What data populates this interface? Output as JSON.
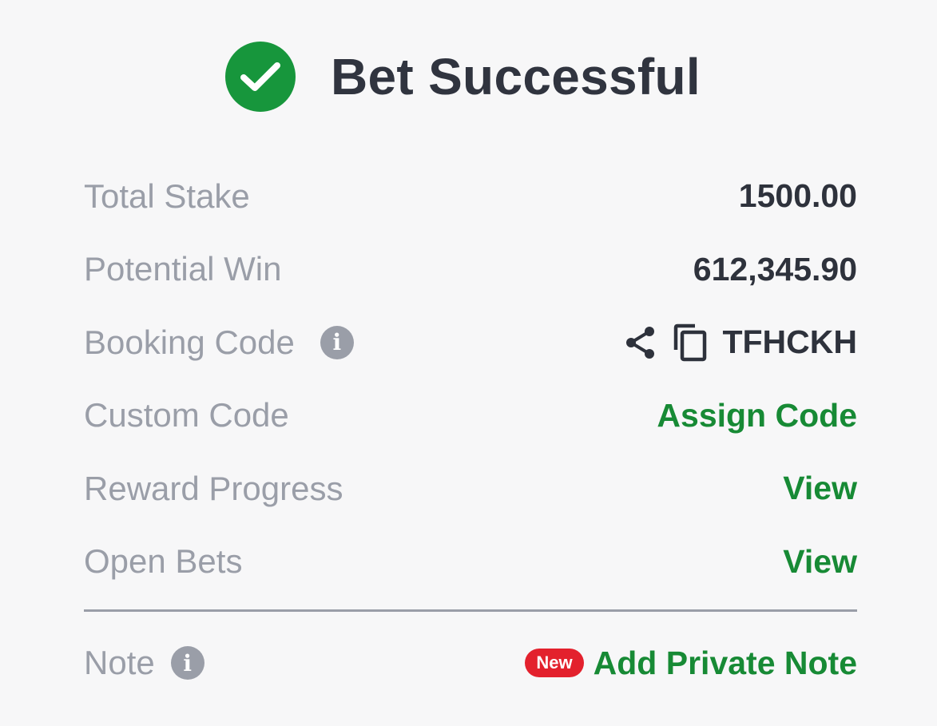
{
  "header": {
    "title": "Bet Successful",
    "icon": "check-circle-icon",
    "accent_color": "#17963c"
  },
  "rows": {
    "total_stake": {
      "label": "Total Stake",
      "value": "1500.00"
    },
    "potential_win": {
      "label": "Potential Win",
      "value": "612,345.90"
    },
    "booking_code": {
      "label": "Booking Code",
      "value": "TFHCKH",
      "info_icon": "i"
    },
    "custom_code": {
      "label": "Custom Code",
      "action": "Assign Code"
    },
    "reward_progress": {
      "label": "Reward Progress",
      "action": "View"
    },
    "open_bets": {
      "label": "Open Bets",
      "action": "View"
    }
  },
  "note": {
    "label": "Note",
    "info_icon": "i",
    "badge": "New",
    "action": "Add Private Note",
    "badge_color": "#e3212d"
  },
  "link_color": "#178a35"
}
